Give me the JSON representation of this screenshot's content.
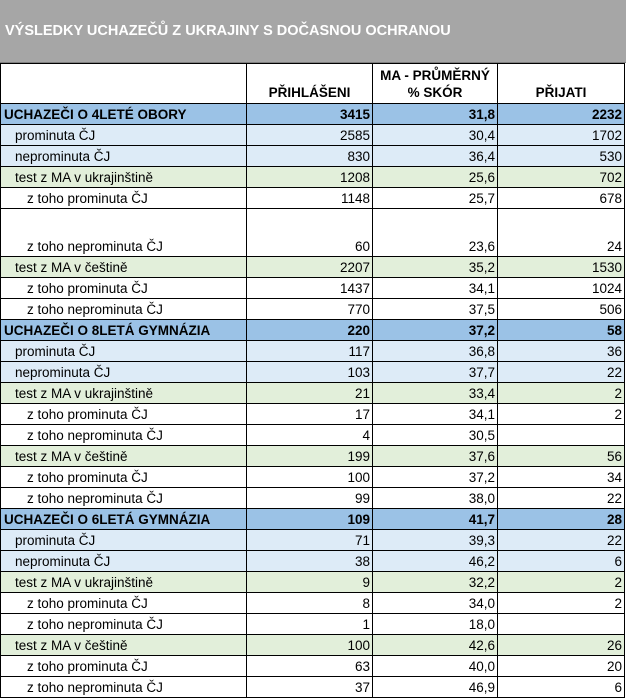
{
  "title": "VÝSLEDKY UCHAZEČŮ Z UKRAJINY S DOČASNOU OCHRANOU",
  "headers": [
    "",
    "PŘIHLÁŠENI",
    "MA - PRŮMĚRNÝ % SKÓR",
    "PŘIJATI"
  ],
  "rows": [
    {
      "label": "UCHAZEČI O 4LETÉ OBORY",
      "prihlaseni": "3415",
      "skor": "31,8",
      "prijati": "2232"
    },
    {
      "label": "prominuta ČJ",
      "prihlaseni": "2585",
      "skor": "30,4",
      "prijati": "1702"
    },
    {
      "label": "neprominuta ČJ",
      "prihlaseni": "830",
      "skor": "36,4",
      "prijati": "530"
    },
    {
      "label": "test z MA v ukrajinštině",
      "prihlaseni": "1208",
      "skor": "25,6",
      "prijati": "702"
    },
    {
      "label": "z toho prominuta ČJ",
      "prihlaseni": "1148",
      "skor": "25,7",
      "prijati": "678"
    },
    {
      "label": "z toho neprominuta ČJ",
      "prihlaseni": "60",
      "skor": "23,6",
      "prijati": "24"
    },
    {
      "label": "test z MA v češtině",
      "prihlaseni": "2207",
      "skor": "35,2",
      "prijati": "1530"
    },
    {
      "label": "z toho prominuta ČJ",
      "prihlaseni": "1437",
      "skor": "34,1",
      "prijati": "1024"
    },
    {
      "label": "z toho neprominuta ČJ",
      "prihlaseni": "770",
      "skor": "37,5",
      "prijati": "506"
    },
    {
      "label": "UCHAZEČI O 8LETÁ GYMNÁZIA",
      "prihlaseni": "220",
      "skor": "37,2",
      "prijati": "58"
    },
    {
      "label": "prominuta ČJ",
      "prihlaseni": "117",
      "skor": "36,8",
      "prijati": "36"
    },
    {
      "label": "neprominuta ČJ",
      "prihlaseni": "103",
      "skor": "37,7",
      "prijati": "22"
    },
    {
      "label": "test z MA v ukrajinštině",
      "prihlaseni": "21",
      "skor": "33,4",
      "prijati": "2"
    },
    {
      "label": "z toho prominuta ČJ",
      "prihlaseni": "17",
      "skor": "34,1",
      "prijati": "2"
    },
    {
      "label": "z toho neprominuta ČJ",
      "prihlaseni": "4",
      "skor": "30,5",
      "prijati": ""
    },
    {
      "label": "test z MA v češtině",
      "prihlaseni": "199",
      "skor": "37,6",
      "prijati": "56"
    },
    {
      "label": "z toho prominuta ČJ",
      "prihlaseni": "100",
      "skor": "37,2",
      "prijati": "34"
    },
    {
      "label": "z toho neprominuta ČJ",
      "prihlaseni": "99",
      "skor": "38,0",
      "prijati": "22"
    },
    {
      "label": "UCHAZEČI O 6LETÁ GYMNÁZIA",
      "prihlaseni": "109",
      "skor": "41,7",
      "prijati": "28"
    },
    {
      "label": "prominuta ČJ",
      "prihlaseni": "71",
      "skor": "39,3",
      "prijati": "22"
    },
    {
      "label": "neprominuta ČJ",
      "prihlaseni": "38",
      "skor": "46,2",
      "prijati": "6"
    },
    {
      "label": "test z MA v ukrajinštině",
      "prihlaseni": "9",
      "skor": "32,2",
      "prijati": "2"
    },
    {
      "label": "z toho prominuta ČJ",
      "prihlaseni": "8",
      "skor": "34,0",
      "prijati": "2"
    },
    {
      "label": "z toho neprominuta ČJ",
      "prihlaseni": "1",
      "skor": "18,0",
      "prijati": ""
    },
    {
      "label": "test z MA v češtině",
      "prihlaseni": "100",
      "skor": "42,6",
      "prijati": "26"
    },
    {
      "label": "z toho prominuta ČJ",
      "prihlaseni": "63",
      "skor": "40,0",
      "prijati": "20"
    },
    {
      "label": "z toho neprominuta ČJ",
      "prihlaseni": "37",
      "skor": "46,9",
      "prijati": "6"
    }
  ]
}
